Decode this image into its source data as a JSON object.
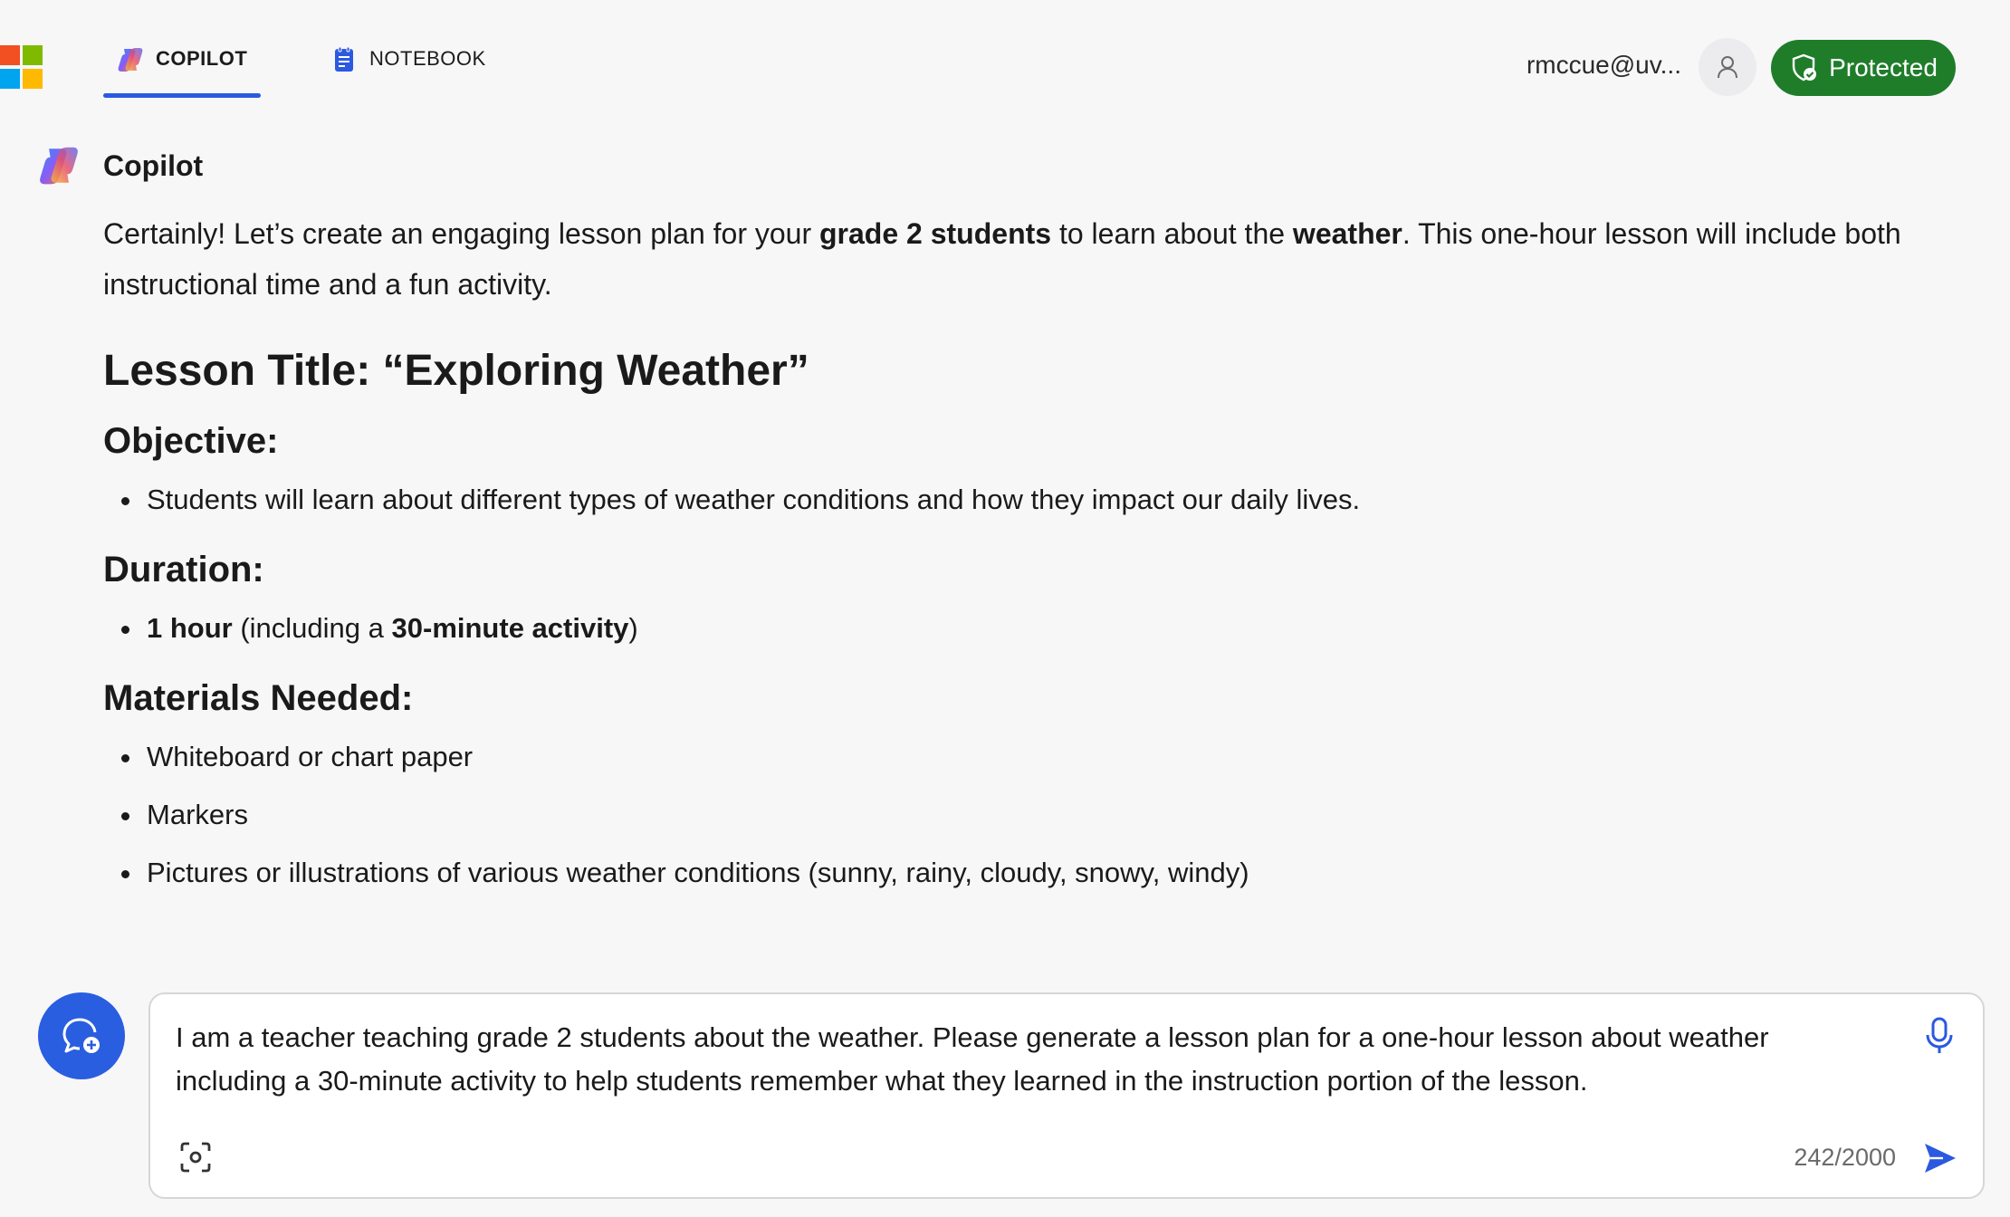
{
  "colors": {
    "accent": "#2b59e0",
    "protected_green": "#1f7d2a",
    "ms_red": "#f25022",
    "ms_green": "#7fba00",
    "ms_blue": "#00a4ef",
    "ms_yellow": "#ffb900"
  },
  "header": {
    "logo_icon": "microsoft-logo",
    "tabs": [
      {
        "label": "COPILOT",
        "icon": "copilot-icon",
        "active": true
      },
      {
        "label": "NOTEBOOK",
        "icon": "notebook-icon",
        "active": false
      }
    ],
    "user_email": "rmccue@uv...",
    "avatar_icon": "person-icon",
    "protected_label": "Protected",
    "protected_icon": "shield-check-icon"
  },
  "message": {
    "sender": "Copilot",
    "intro": {
      "t1": "Certainly! Let’s create an engaging lesson plan for your ",
      "b1": "grade 2 students",
      "t2": " to learn about the ",
      "b2": "weather",
      "t3": ". This one-hour lesson will include both instructional time and a fun activity."
    },
    "lesson_title": "Lesson Title: “Exploring Weather”",
    "objective": {
      "heading": "Objective:",
      "items": [
        "Students will learn about different types of weather conditions and how they impact our daily lives."
      ]
    },
    "duration": {
      "heading": "Duration:",
      "b1": "1 hour",
      "t1": " (including a ",
      "b2": "30-minute activity",
      "t2": ")"
    },
    "materials": {
      "heading": "Materials Needed:",
      "items": [
        "Whiteboard or chart paper",
        "Markers",
        "Pictures or illustrations of various weather conditions (sunny, rainy, cloudy, snowy, windy)"
      ]
    }
  },
  "composer": {
    "new_chat_icon": "new-chat-icon",
    "input_text": "I am a teacher teaching grade 2 students about the weather. Please generate a lesson plan for a one-hour lesson about weather including a 30-minute activity to help students remember what they learned in the instruction portion of the lesson.",
    "char_count": "242/2000",
    "mic_icon": "microphone-icon",
    "screenshot_icon": "screenshot-icon",
    "send_icon": "send-icon"
  }
}
